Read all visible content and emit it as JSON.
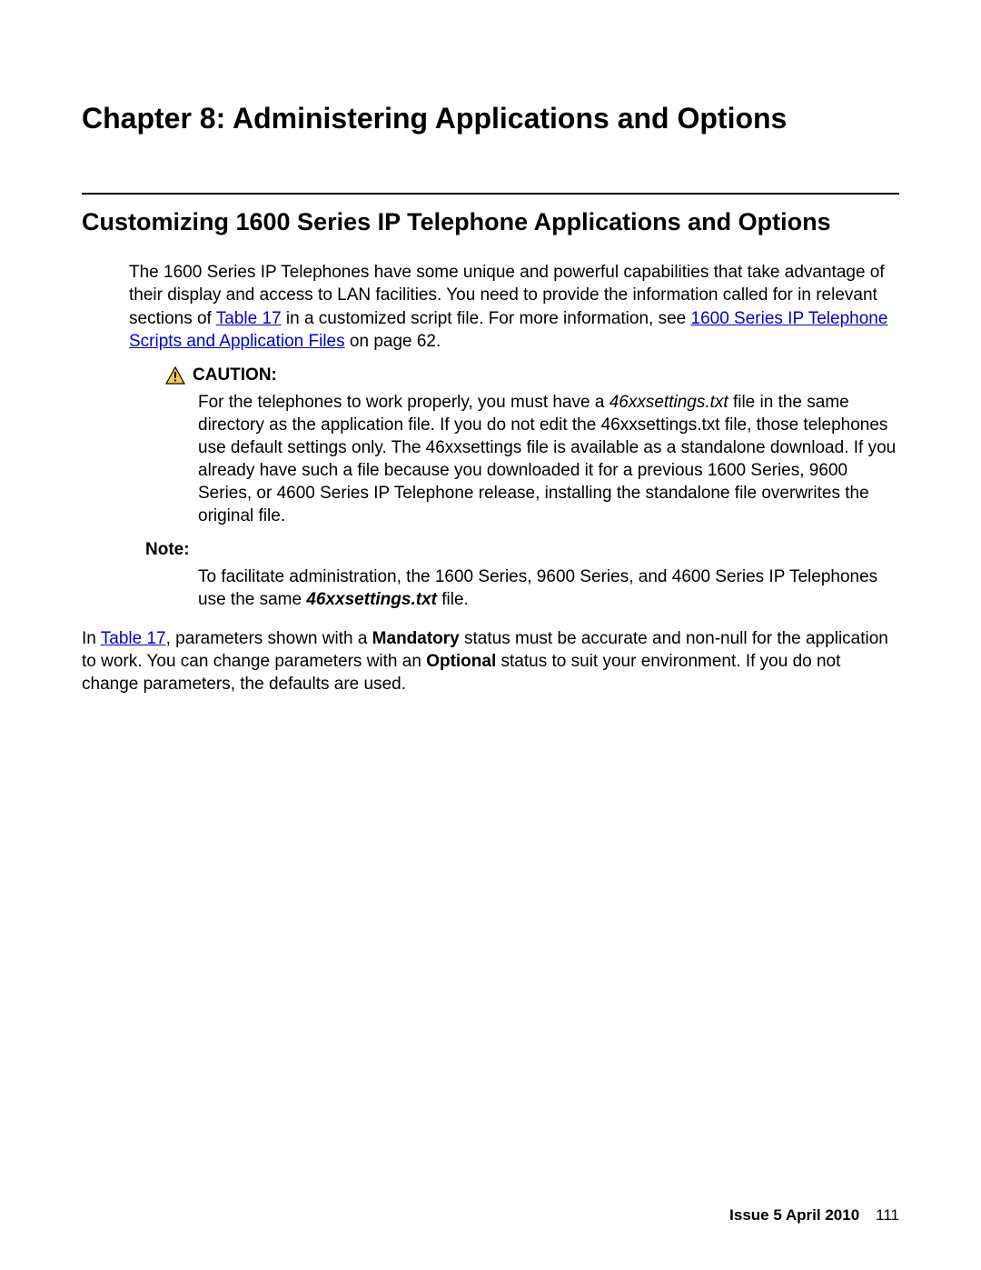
{
  "chapter": {
    "title": "Chapter 8:   Administering Applications and Options"
  },
  "section": {
    "title": "Customizing 1600 Series IP Telephone Applications and Options"
  },
  "para1": {
    "part1": "The 1600 Series IP Telephones have some unique and powerful capabilities that take advantage of their display and access to LAN facilities. You need to provide the information called for in relevant sections of ",
    "link1": "Table 17",
    "part2": " in a customized script file. For more information, see ",
    "link2": "1600 Series IP Telephone Scripts and Application Files",
    "part3": " on page 62."
  },
  "caution": {
    "label": "CAUTION:",
    "body_part1": "For the telephones to work properly, you must have a ",
    "body_italic": "46xxsettings.txt",
    "body_part2": " file in the same directory as the application file. If you do not edit the 46xxsettings.txt file, those telephones use default settings only. The 46xxsettings file is available as a standalone download. If you already have such a file because you downloaded it for a previous 1600 Series, 9600 Series, or 4600 Series IP Telephone release, installing the standalone file overwrites the original file."
  },
  "note": {
    "label": "Note:",
    "body_part1": "To facilitate administration, the 1600 Series, 9600 Series, and 4600 Series IP Telephones use the same ",
    "body_bolditalic": "46xxsettings.txt",
    "body_part2": " file."
  },
  "para2": {
    "part1": "In ",
    "link1": "Table 17",
    "part2": ", parameters shown with a ",
    "bold1": "Mandatory",
    "part3": " status must be accurate and non-null for the application to work. You can change parameters with an ",
    "bold2": "Optional",
    "part4": " status to suit your environment. If you do not change parameters, the defaults are used."
  },
  "footer": {
    "issue": "Issue 5   April 2010",
    "page": "111"
  }
}
